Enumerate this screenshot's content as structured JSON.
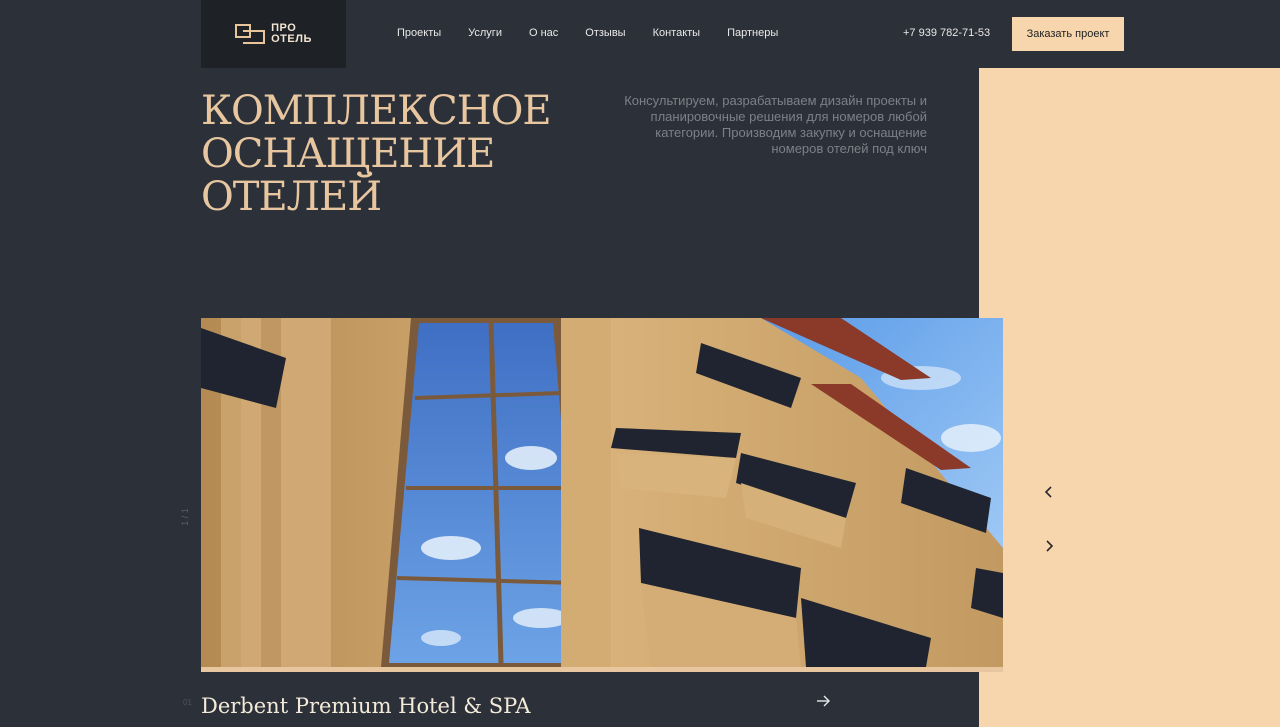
{
  "logo": {
    "line1": "ПРО",
    "line2": "ОТЕЛЬ"
  },
  "nav": [
    {
      "label": "Проекты"
    },
    {
      "label": "Услуги"
    },
    {
      "label": "О нас"
    },
    {
      "label": "Отзывы"
    },
    {
      "label": "Контакты"
    },
    {
      "label": "Партнеры"
    }
  ],
  "header": {
    "phone": "+7 939 782-71-53",
    "cta_label": "Заказать проект"
  },
  "hero": {
    "headline": "КОМПЛЕКСНОЕ ОСНАЩЕНИЕ ОТЕЛЕЙ",
    "lead": "Консультируем, разрабатываем дизайн проекты и планировочные решения для номеров любой категории. Производим закупку и оснащение номеров отелей под ключ"
  },
  "slider": {
    "counter": "1 / 1",
    "slide_number": "01",
    "title": "Derbent Premium Hotel & SPA",
    "icons": {
      "prev": "chevron-left-icon",
      "next": "chevron-right-icon",
      "open": "arrow-right-icon"
    }
  },
  "colors": {
    "background": "#2c3038",
    "accent": "#f7d6ae",
    "headline": "#e7c6a0"
  }
}
